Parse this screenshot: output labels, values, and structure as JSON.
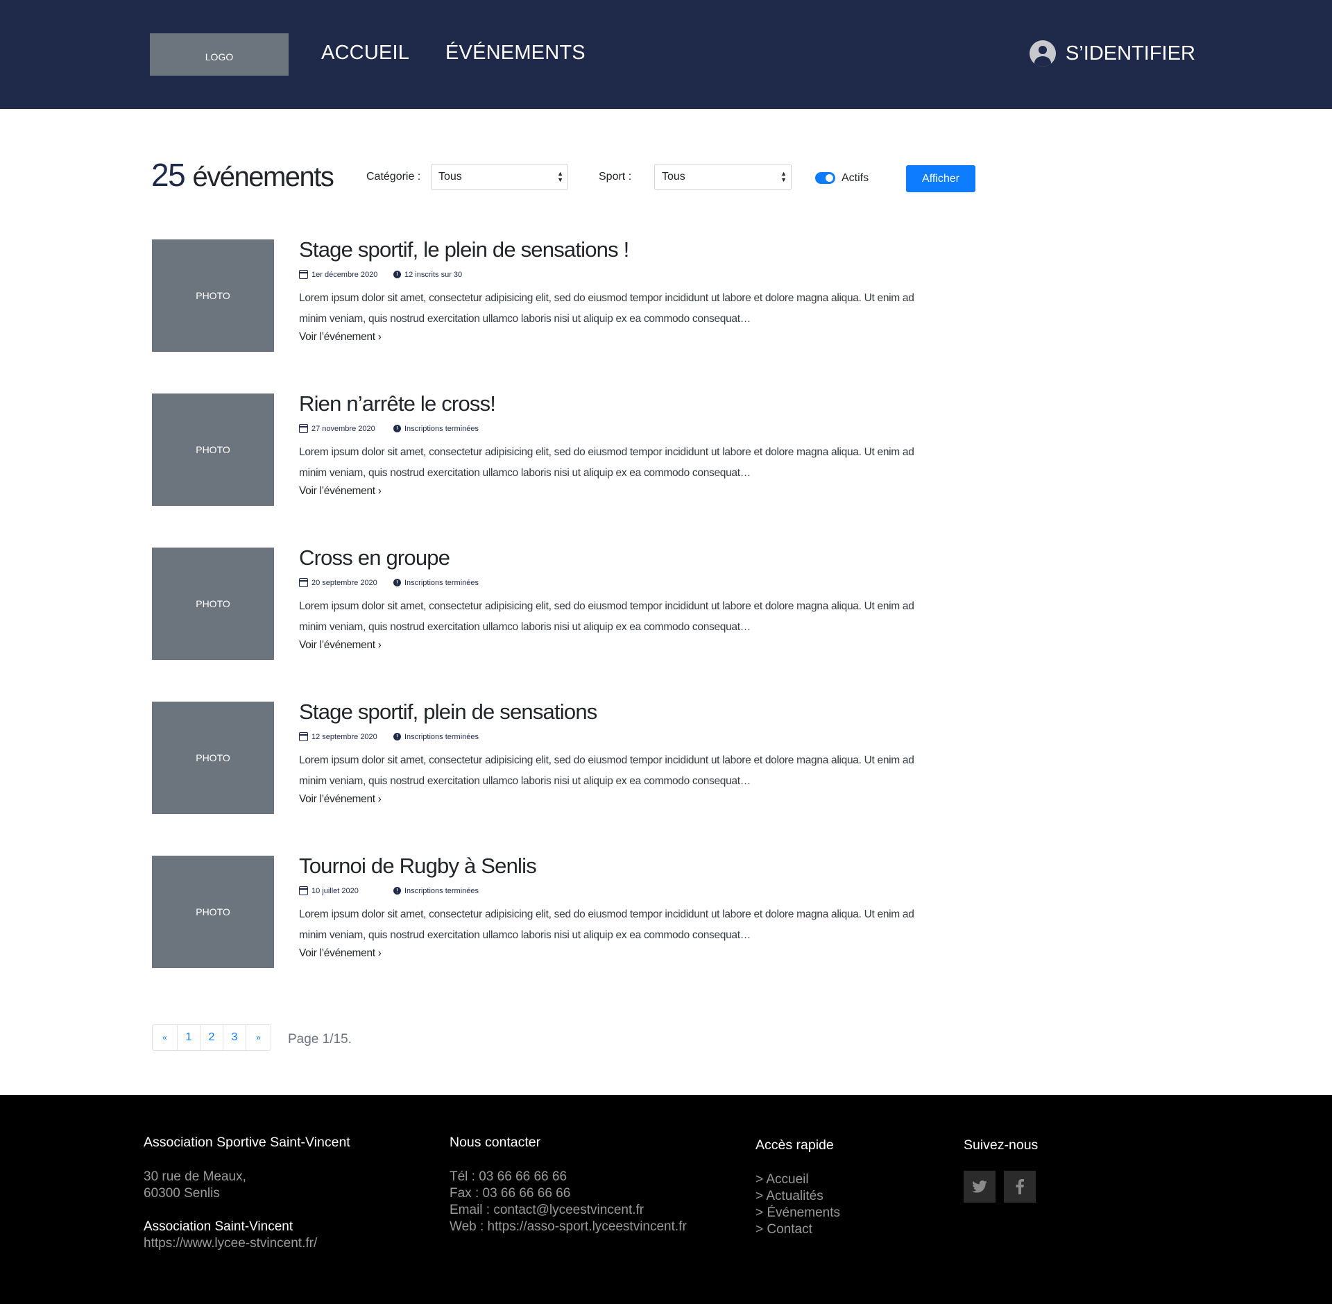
{
  "header": {
    "logo": "LOGO",
    "nav": [
      "ACCUEIL",
      "ÉVÉNEMENTS"
    ],
    "login": "S’IDENTIFIER"
  },
  "filters": {
    "count_number": "25",
    "count_word": "événements",
    "category_label": "Catégorie :",
    "category_value": "Tous",
    "sport_label": "Sport :",
    "sport_value": "Tous",
    "active_label": "Actifs",
    "active_on": true,
    "show_button": "Afficher"
  },
  "events": [
    {
      "photo": "PHOTO",
      "title": "Stage sportif, le plein de sensations !",
      "date": "1er décembre 2020",
      "status": "12 inscrits sur 30",
      "desc": "Lorem ipsum dolor sit amet, consectetur adipisicing elit, sed do eiusmod tempor incididunt ut labore et dolore magna aliqua. Ut enim ad minim veniam, quis nostrud exercitation ullamco laboris nisi ut aliquip ex ea commodo consequat…",
      "more": "Voir l’événement ›"
    },
    {
      "photo": "PHOTO",
      "title": "Rien n’arrête le cross!",
      "date": "27 novembre 2020",
      "status": "Inscriptions terminées",
      "desc": "Lorem ipsum dolor sit amet, consectetur adipisicing elit, sed do eiusmod tempor incididunt ut labore et dolore magna aliqua. Ut enim ad minim veniam, quis nostrud exercitation ullamco laboris nisi ut aliquip ex ea commodo consequat…",
      "more": "Voir l’événement ›"
    },
    {
      "photo": "PHOTO",
      "title": "Cross en groupe",
      "date": "20 septembre 2020",
      "status": "Inscriptions terminées",
      "desc": "Lorem ipsum dolor sit amet, consectetur adipisicing elit, sed do eiusmod tempor incididunt ut labore et dolore magna aliqua. Ut enim ad minim veniam, quis nostrud exercitation ullamco laboris nisi ut aliquip ex ea commodo consequat…",
      "more": "Voir l’événement ›"
    },
    {
      "photo": "PHOTO",
      "title": "Stage sportif, plein de sensations",
      "date": "12 septembre 2020",
      "status": "Inscriptions terminées",
      "desc": "Lorem ipsum dolor sit amet, consectetur adipisicing elit, sed do eiusmod tempor incididunt ut labore et dolore magna aliqua. Ut enim ad minim veniam, quis nostrud exercitation ullamco laboris nisi ut aliquip ex ea commodo consequat…",
      "more": "Voir l’événement ›"
    },
    {
      "photo": "PHOTO",
      "title": "Tournoi de Rugby à Senlis",
      "date": "10 juillet 2020",
      "status": "Inscriptions terminées",
      "desc": "Lorem ipsum dolor sit amet, consectetur adipisicing elit, sed do eiusmod tempor incididunt ut labore et dolore magna aliqua. Ut enim ad minim veniam, quis nostrud exercitation ullamco laboris nisi ut aliquip ex ea commodo consequat…",
      "more": "Voir l’événement ›"
    }
  ],
  "pagination": {
    "prev": "«",
    "pages": [
      "1",
      "2",
      "3"
    ],
    "next": "»",
    "info": "Page 1/15."
  },
  "footer": {
    "col1": {
      "title": "Association Sportive Saint-Vincent",
      "address1": "30 rue de Meaux,",
      "address2": "60300 Senlis",
      "org": "Association Saint-Vincent",
      "url": "https://www.lycee-stvincent.fr/"
    },
    "col2": {
      "title": "Nous contacter",
      "tel": "Tél : 03 66 66 66 66",
      "fax": "Fax : 03 66 66 66 66",
      "email": "Email : contact@lyceestvincent.fr",
      "web": "Web : https://asso-sport.lyceestvincent.fr"
    },
    "col3": {
      "title": "Accès rapide",
      "links": [
        "> Accueil",
        "> Actualités",
        "> Événements",
        "> Contact"
      ]
    },
    "col4": {
      "title": "Suivez-nous",
      "icons": [
        "twitter-icon",
        "facebook-icon"
      ]
    }
  }
}
